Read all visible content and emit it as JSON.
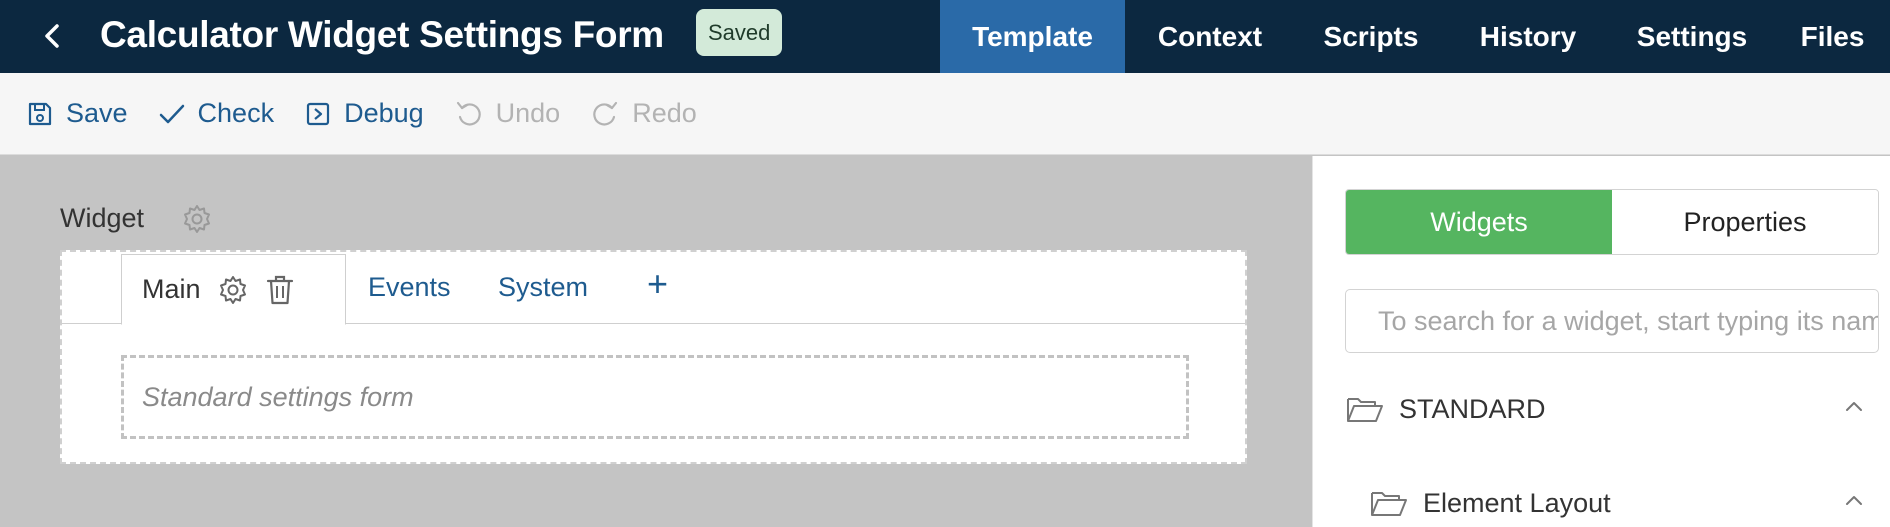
{
  "header": {
    "title": "Calculator Widget Settings Form",
    "status_badge": "Saved",
    "tabs": [
      {
        "label": "Template",
        "active": true
      },
      {
        "label": "Context",
        "active": false
      },
      {
        "label": "Scripts",
        "active": false
      },
      {
        "label": "History",
        "active": false
      },
      {
        "label": "Settings",
        "active": false
      },
      {
        "label": "Files",
        "active": false
      }
    ]
  },
  "toolbar": {
    "save": "Save",
    "check": "Check",
    "debug": "Debug",
    "undo": "Undo",
    "redo": "Redo"
  },
  "canvas": {
    "widget_label": "Widget",
    "tabs": {
      "main": "Main",
      "events": "Events",
      "system": "System",
      "add": "+"
    },
    "form_placeholder": "Standard settings form"
  },
  "panel": {
    "segments": {
      "widgets": "Widgets",
      "properties": "Properties"
    },
    "search_placeholder": "To search for a widget, start typing its name",
    "groups": [
      {
        "label": "STANDARD"
      },
      {
        "label": "Element Layout"
      }
    ]
  },
  "colors": {
    "header_bg": "#0c2840",
    "active_tab": "#2a6aa8",
    "link": "#1e5b8f",
    "success": "#55b560",
    "badge_bg": "#d3ead9"
  }
}
